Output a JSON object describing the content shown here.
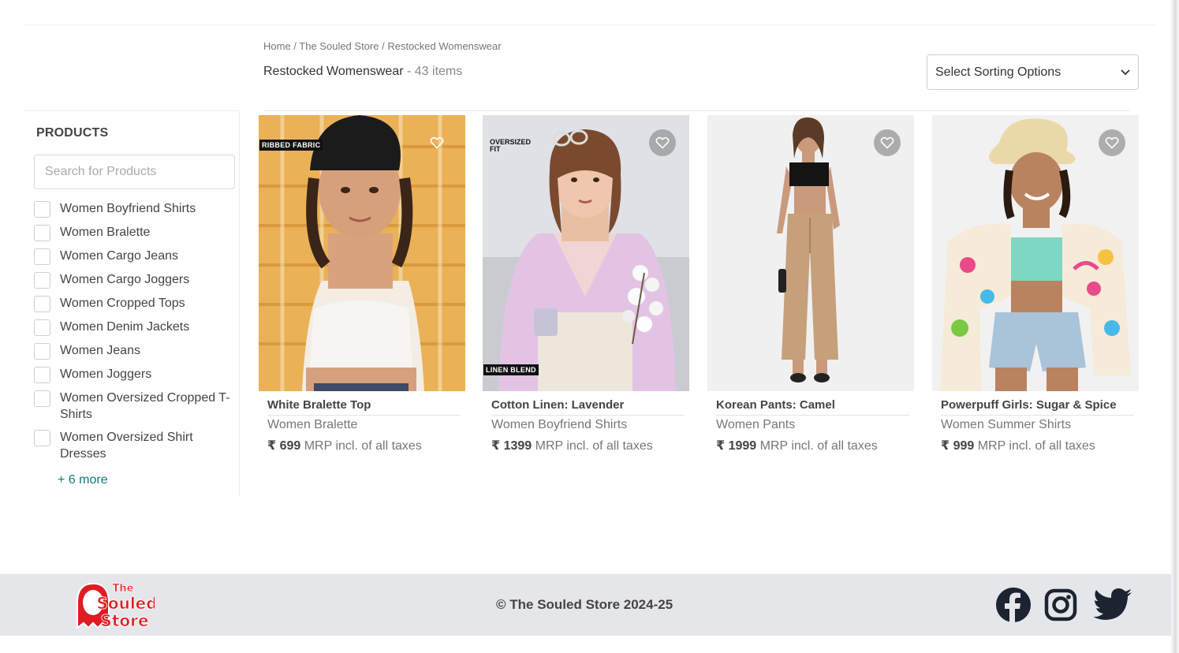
{
  "breadcrumb": {
    "home": "Home",
    "sep1": " / ",
    "store": "The Souled Store",
    "sep2": " / ",
    "current": "Restocked Womenswear"
  },
  "heading": {
    "title": "Restocked Womenswear",
    "count": " - 43 items"
  },
  "sort": {
    "label": "Select Sorting Options"
  },
  "sidebar": {
    "title": "PRODUCTS",
    "search_placeholder": "Search for Products",
    "filters": [
      "Women Boyfriend Shirts",
      "Women Bralette",
      "Women Cargo Jeans",
      "Women Cargo Joggers",
      "Women Cropped Tops",
      "Women Denim Jackets",
      "Women Jeans",
      "Women Joggers",
      "Women Oversized Cropped T-Shirts",
      "Women Oversized Shirt Dresses"
    ],
    "more": "+ 6 more"
  },
  "products": [
    {
      "name": "White Bralette Top",
      "category": "Women Bralette",
      "price": "₹ 699",
      "price_note": " MRP incl. of all taxes",
      "tag": "RIBBED FABRIC"
    },
    {
      "name": "Cotton Linen: Lavender",
      "category": "Women Boyfriend Shirts",
      "price": "₹ 1399",
      "price_note": " MRP incl. of all taxes",
      "tag_top": "OVERSIZED",
      "tag_top2": "FIT",
      "tag_bottom": "LINEN BLEND"
    },
    {
      "name": "Korean Pants: Camel",
      "category": "Women Pants",
      "price": "₹ 1999",
      "price_note": " MRP incl. of all taxes"
    },
    {
      "name": "Powerpuff Girls: Sugar & Spice",
      "category": "Women Summer Shirts",
      "price": "₹ 999",
      "price_note": " MRP incl. of all taxes"
    }
  ],
  "footer": {
    "copyright": "© The Souled Store 2024-25",
    "logo_line1": "The",
    "logo_line2": "Souled",
    "logo_line3": "Store"
  },
  "colors": {
    "accent_link": "#117a7a",
    "brand_red": "#e11b22",
    "footer_bg": "#e5e6ea"
  }
}
